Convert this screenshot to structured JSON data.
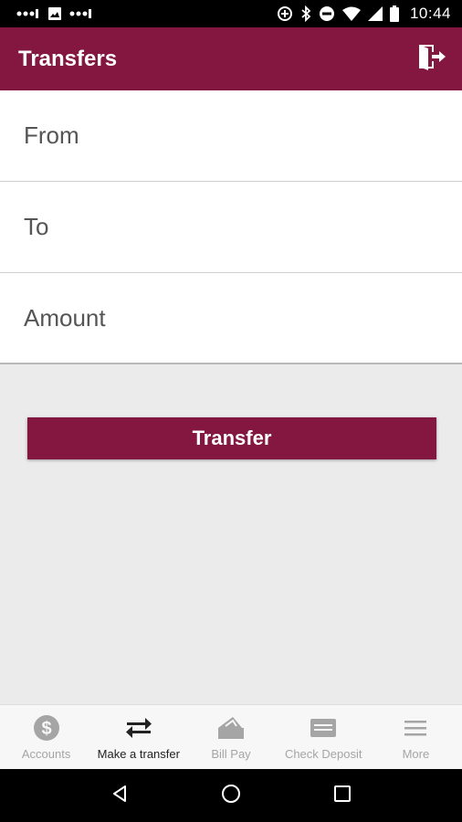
{
  "status_bar": {
    "time": "10:44",
    "icons": [
      "signal-dots-icon",
      "image-icon",
      "signal-dots-icon",
      "data-saver-icon",
      "bluetooth-icon",
      "do-not-disturb-icon",
      "wifi-icon",
      "cell-signal-icon",
      "battery-icon"
    ]
  },
  "app_bar": {
    "title": "Transfers",
    "action_icon": "logout-icon"
  },
  "form": {
    "from_label": "From",
    "to_label": "To",
    "amount_label": "Amount"
  },
  "transfer_button": {
    "label": "Transfer"
  },
  "tabs": [
    {
      "label": "Accounts",
      "icon": "dollar-icon",
      "active": false
    },
    {
      "label": "Make a transfer",
      "icon": "transfer-arrows-icon",
      "active": true
    },
    {
      "label": "Bill Pay",
      "icon": "bill-pay-icon",
      "active": false
    },
    {
      "label": "Check Deposit",
      "icon": "check-deposit-icon",
      "active": false
    },
    {
      "label": "More",
      "icon": "menu-icon",
      "active": false
    }
  ],
  "nav_bar": {
    "buttons": [
      "back-icon",
      "home-icon",
      "recents-icon"
    ]
  },
  "colors": {
    "brand": "#83173f",
    "background": "#ebebeb",
    "tab_active": "#222222",
    "tab_inactive": "#a5a5a5"
  }
}
